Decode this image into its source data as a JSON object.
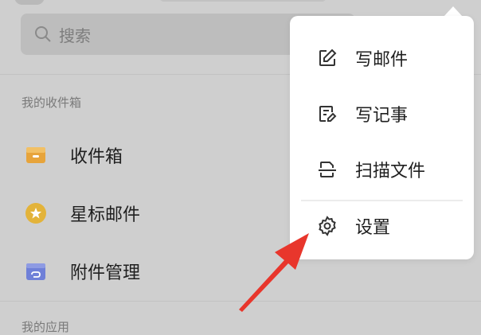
{
  "search": {
    "placeholder": "搜索",
    "icon": "search-icon"
  },
  "sections": {
    "inbox_section": "我的收件箱",
    "apps_section": "我的应用"
  },
  "mailbox_items": [
    {
      "label": "收件箱",
      "icon": "inbox-icon",
      "color": "#e7a43b"
    },
    {
      "label": "星标邮件",
      "icon": "star-icon",
      "color": "#e3b33a"
    },
    {
      "label": "附件管理",
      "icon": "attachment-icon",
      "color": "#6f80d8"
    }
  ],
  "menu": {
    "items": [
      {
        "label": "写邮件",
        "icon": "compose-icon"
      },
      {
        "label": "写记事",
        "icon": "note-icon"
      },
      {
        "label": "扫描文件",
        "icon": "scan-icon"
      },
      {
        "label": "设置",
        "icon": "settings-icon"
      }
    ]
  },
  "colors": {
    "annotation_arrow": "#e8362c",
    "overlay": "#cfcfcf"
  }
}
